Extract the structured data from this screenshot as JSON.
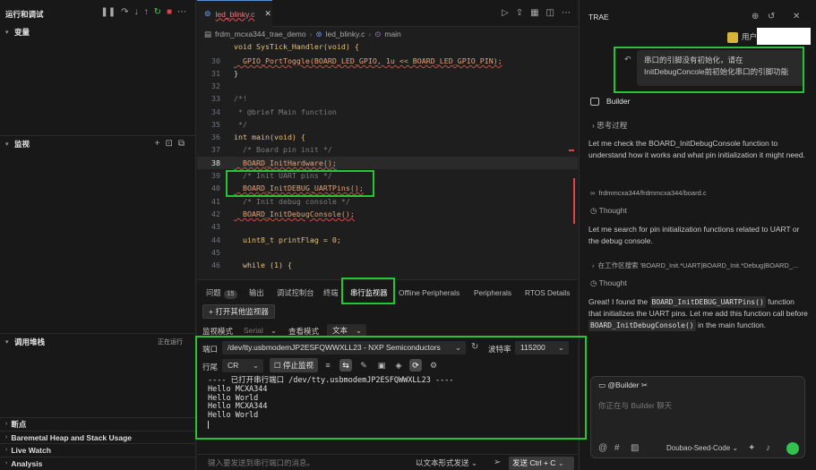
{
  "sidebar": {
    "title": "运行和调试",
    "variables": "变量",
    "watch": "监视",
    "callstack": "调用堆栈",
    "callstack_status": "正在运行",
    "breakpoints": "断点",
    "heap": "Baremetal Heap and Stack Usage",
    "livewatch": "Live Watch",
    "analysis": "Analysis"
  },
  "editor": {
    "tab_name": "led_blinky.c",
    "breadcrumb": [
      "frdm_mcxa344_trae_demo",
      "led_blinky.c",
      "main"
    ],
    "lines": [
      {
        "num": "",
        "text": "void SysTick_Handler(void) {"
      },
      {
        "num": "30",
        "text": "  GPIO_PortToggle(BOARD_LED_GPIO, 1u << BOARD_LED_GPIO_PIN);"
      },
      {
        "num": "31",
        "text": "}"
      },
      {
        "num": "32",
        "text": ""
      },
      {
        "num": "33",
        "text": "/*!"
      },
      {
        "num": "34",
        "text": " * @brief Main function"
      },
      {
        "num": "35",
        "text": " */"
      },
      {
        "num": "36",
        "text": "int main(void) {"
      },
      {
        "num": "37",
        "text": "  /* Board pin init */"
      },
      {
        "num": "38",
        "text": "  BOARD_InitHardware();"
      },
      {
        "num": "39",
        "text": "  /* Init UART pins */"
      },
      {
        "num": "40",
        "text": "  BOARD_InitDEBUG_UARTPins();"
      },
      {
        "num": "41",
        "text": "  /* Init debug console */"
      },
      {
        "num": "42",
        "text": "  BOARD_InitDebugConsole();"
      },
      {
        "num": "43",
        "text": ""
      },
      {
        "num": "44",
        "text": "  uint8_t printFlag = 0;"
      },
      {
        "num": "45",
        "text": ""
      },
      {
        "num": "46",
        "text": "  while (1) {"
      }
    ]
  },
  "panel": {
    "tabs": [
      "问题",
      "输出",
      "调试控制台",
      "终端",
      "串行监视器",
      "Offline Peripherals",
      "Peripherals",
      "RTOS Details"
    ],
    "problems_count": "15",
    "open_monitor_btn": "打开其他监视器",
    "monitor_mode_label": "监视模式",
    "monitor_mode_value": "Serial",
    "view_mode_label": "查看模式",
    "view_mode_value": "文本",
    "port_label": "端口",
    "port_value": "/dev/tty.usbmodemJP2ESFQWWXLL23 - NXP Semiconductors",
    "baud_label": "波特率",
    "baud_value": "115200",
    "line_end_label": "行尾",
    "line_end_value": "CR",
    "stop_btn": "停止监视",
    "output": "---- 已打开串行端口 /dev/tty.usbmodemJP2ESFQWWXLL23 ----\nHello MCXA344\nHello World\nHello MCXA344\nHello World",
    "send_placeholder": "键入要发送到串行端口的消息。",
    "send_mode": "以文本形式发送",
    "send_btn": "发送 Ctrl + C"
  },
  "chat": {
    "title": "TRAE",
    "user_label": "用户",
    "user_message": "串口的引脚没有初始化，请在InitDebugConcole前初始化串口的引脚功能",
    "agent_name": "Builder",
    "thinking": "思考过程",
    "p1": "Let me check the BOARD_InitDebugConsole function to understand how it works and what pin initialization it might need.",
    "file_ref": "frdmmcxa344/frdmmcxa344/board.c",
    "thought1": "Thought",
    "p2": "Let me search for pin initialization functions related to UART or the debug console.",
    "search_ref": "在工作区搜索 'BOARD_Init.*UART|BOARD_Init.*Debug|BOARD_...",
    "thought2": "Thought",
    "p3a": "Great! I found the",
    "p3_code1": "BOARD_InitDEBUG_UARTPins()",
    "p3b": "function that initializes the UART pins. Let me add this function call before",
    "p3_code2": "BOARD_InitDebugConsole()",
    "p3c": "in the main function.",
    "composer_agent": "@Builder",
    "composer_placeholder": "你正在与 Builder 聊天",
    "model": "Doubao-Seed-Code"
  }
}
